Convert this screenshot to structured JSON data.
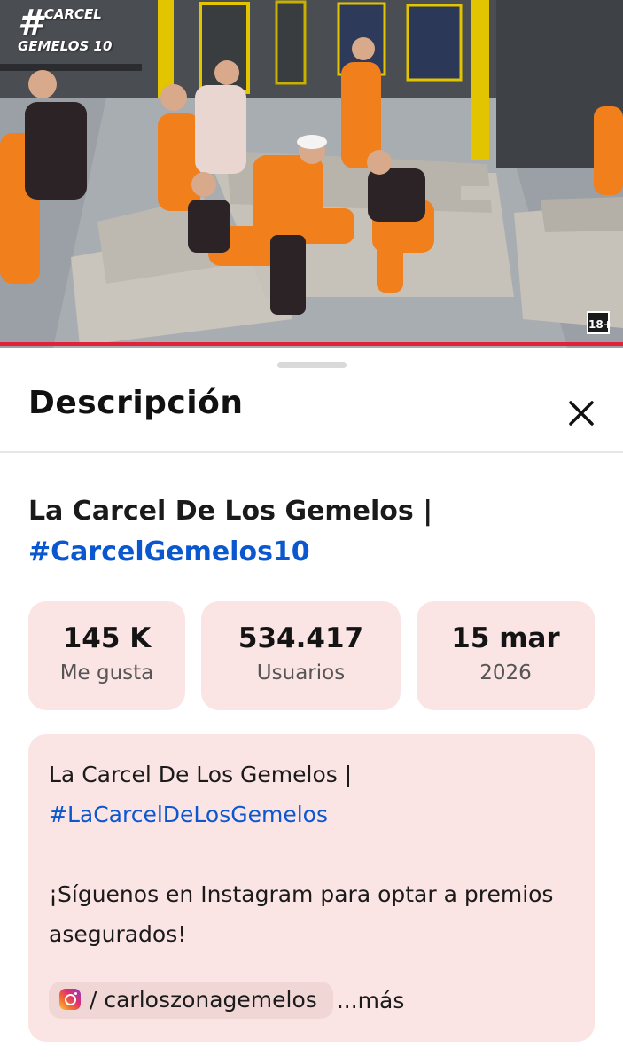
{
  "video": {
    "logo_hash": "#",
    "logo_line1": "CARCEL",
    "logo_line2": "GEMELOS 10",
    "rating": "18+"
  },
  "sheet": {
    "title": "Descripción",
    "close_icon": "close-icon"
  },
  "video_info": {
    "title": "La Carcel De Los Gemelos |",
    "hashtag": "#CarcelGemelos10"
  },
  "stats": [
    {
      "value": "145 K",
      "label": "Me gusta"
    },
    {
      "value": "534.417",
      "label": "Usuarios"
    },
    {
      "value": "15 mar",
      "label": "2026"
    }
  ],
  "description": {
    "line1": "La Carcel De Los Gemelos |",
    "hashtag": "#LaCarcelDeLosGemelos",
    "promo": "¡Síguenos en Instagram para optar a premios asegurados!",
    "instagram_handle": "/ carloszonagemelos",
    "instagram_icon": "instagram-icon",
    "more_label": "...más"
  },
  "colors": {
    "accent_link": "#0b57d0",
    "card_bg": "#fbe4e4",
    "progress": "#e0233b"
  }
}
